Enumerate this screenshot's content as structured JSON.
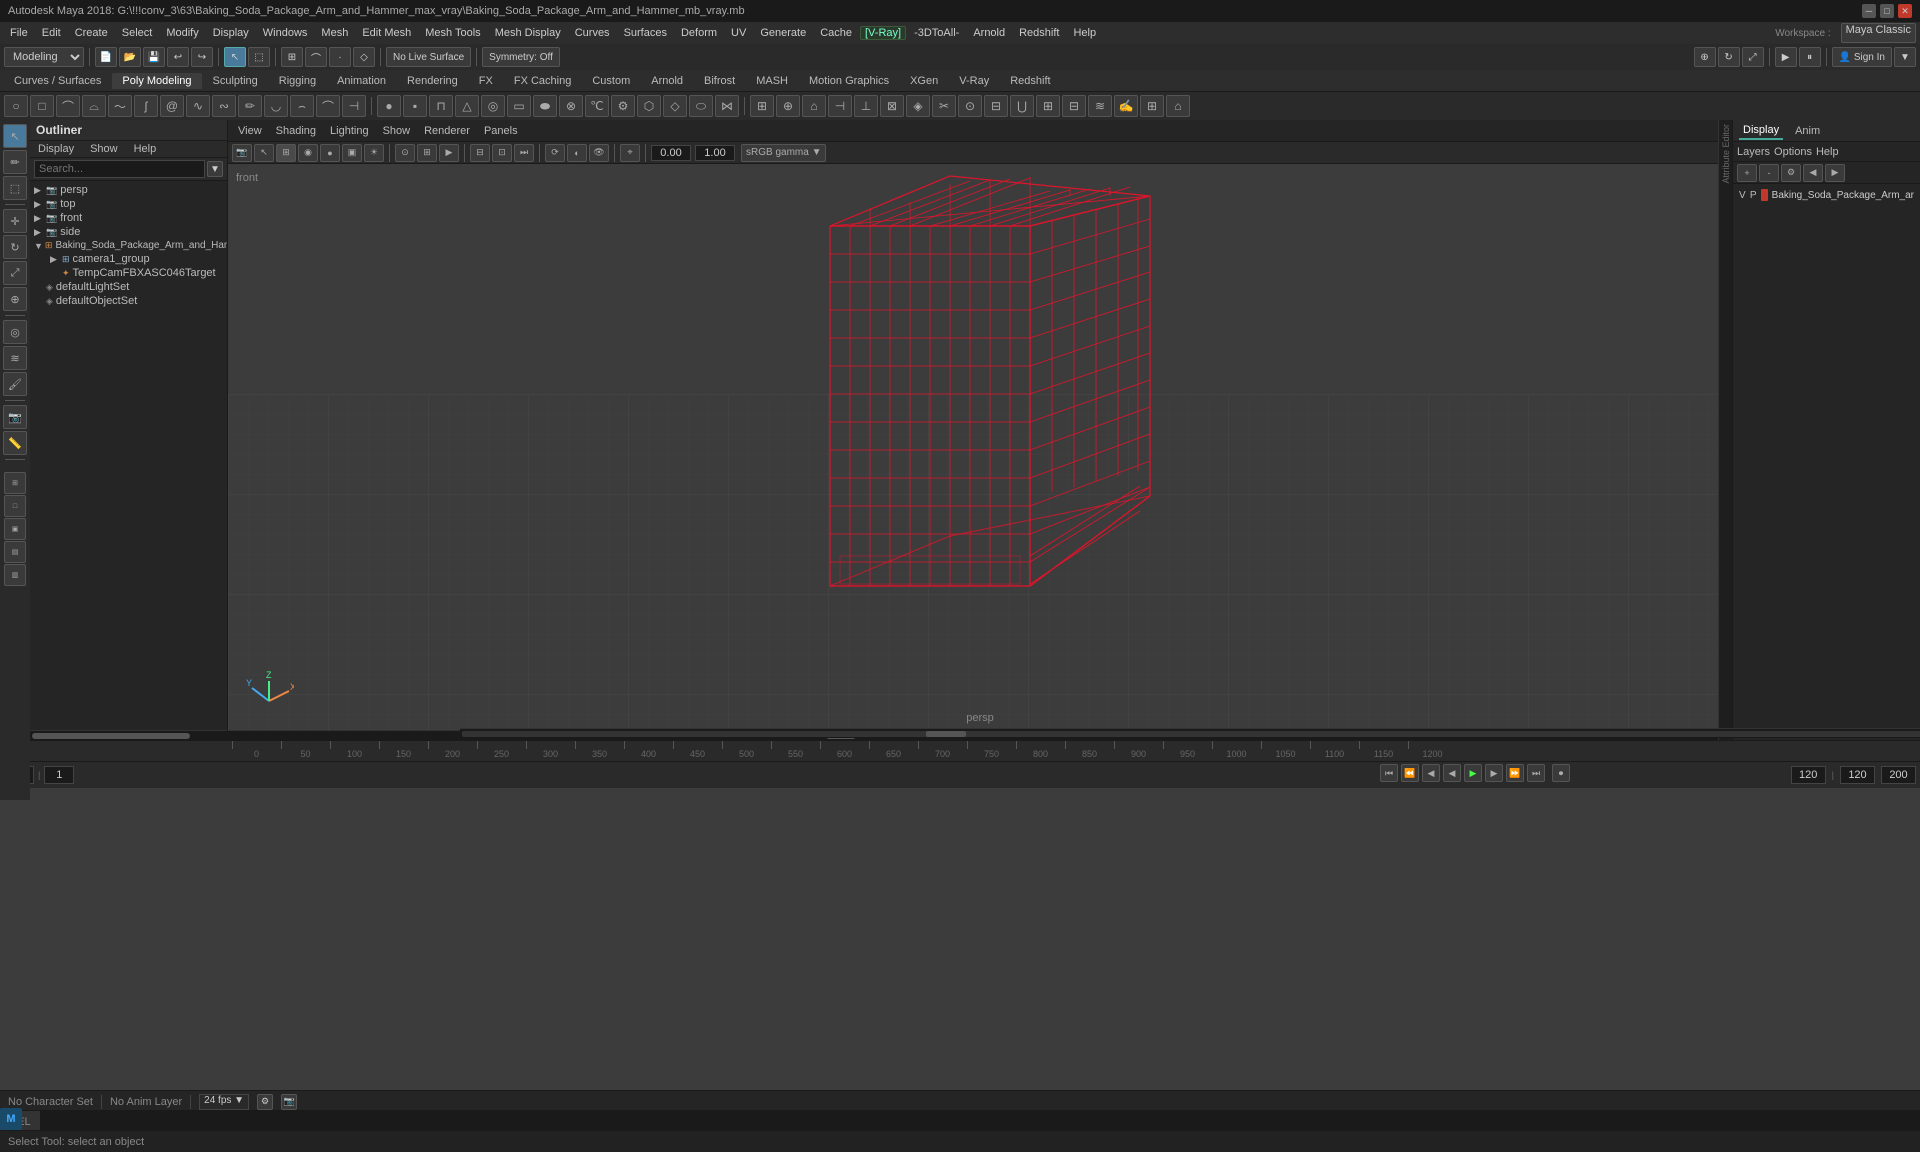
{
  "titleBar": {
    "title": "Autodesk Maya 2018: G:\\!!!conv_3\\63\\Baking_Soda_Package_Arm_and_Hammer_max_vray\\Baking_Soda_Package_Arm_and_Hammer_mb_vray.mb"
  },
  "menuBar": {
    "items": [
      "File",
      "Edit",
      "Create",
      "Select",
      "Modify",
      "Display",
      "Windows",
      "Mesh",
      "Edit Mesh",
      "Mesh Tools",
      "Mesh Display",
      "Curves",
      "Surfaces",
      "Deform",
      "UV",
      "Generate",
      "Cache",
      "V-Ray",
      "3DToAll",
      "Arnold",
      "Redshift",
      "Help"
    ]
  },
  "mainToolbar": {
    "workspace_label": "Workspace :",
    "workspace_value": "Maya Classic",
    "mode_dropdown": "Modeling",
    "no_live_surface": "No Live Surface",
    "symmetry_off": "Symmetry: Off",
    "sign_in": "Sign In"
  },
  "moduleTabs": {
    "items": [
      "Curves / Surfaces",
      "Poly Modeling",
      "Sculpting",
      "Rigging",
      "Animation",
      "Rendering",
      "FX",
      "FX Caching",
      "Custom",
      "Arnold",
      "Bifrost",
      "MASH",
      "Motion Graphics",
      "XGen",
      "V-Ray",
      "Redshift"
    ]
  },
  "outliner": {
    "header": "Outliner",
    "menu": [
      "Display",
      "Show",
      "Help"
    ],
    "search_placeholder": "Search...",
    "items": [
      {
        "label": "persp",
        "indent": 0,
        "type": "camera",
        "expanded": false
      },
      {
        "label": "top",
        "indent": 0,
        "type": "camera",
        "expanded": false
      },
      {
        "label": "front",
        "indent": 0,
        "type": "camera",
        "expanded": false
      },
      {
        "label": "side",
        "indent": 0,
        "type": "camera",
        "expanded": false
      },
      {
        "label": "Baking_Soda_Package_Arm_and_Ham",
        "indent": 0,
        "type": "group",
        "expanded": true
      },
      {
        "label": "camera1_group",
        "indent": 1,
        "type": "group",
        "expanded": false
      },
      {
        "label": "TempCamFBXASC046Target",
        "indent": 2,
        "type": "object",
        "expanded": false
      },
      {
        "label": "defaultLightSet",
        "indent": 0,
        "type": "set",
        "expanded": false
      },
      {
        "label": "defaultObjectSet",
        "indent": 0,
        "type": "set",
        "expanded": false
      }
    ]
  },
  "viewport": {
    "menus": [
      "View",
      "Shading",
      "Lighting",
      "Show",
      "Renderer",
      "Panels"
    ],
    "persp_label": "persp",
    "front_label": "front",
    "gamma_label": "sRGB gamma",
    "field1_value": "0.00",
    "field2_value": "1.00"
  },
  "rightPanel": {
    "tabs": [
      "Display",
      "Anim"
    ],
    "menu": [
      "Layers",
      "Options",
      "Help"
    ],
    "channel_label": "V",
    "channel_p": "P",
    "object_name": "Baking_Soda_Package_Arm_ar",
    "color": "#c0392b"
  },
  "timeline": {
    "ticks": [
      "0",
      "50",
      "100",
      "150",
      "200",
      "250",
      "300",
      "350",
      "400",
      "450",
      "500",
      "550",
      "600",
      "650",
      "700",
      "750",
      "800",
      "850",
      "900",
      "950",
      "1000",
      "1050",
      "1100",
      "1150",
      "1200"
    ],
    "current_frame": "1",
    "start_frame": "1",
    "end_frame": "120",
    "range_end": "200",
    "range_start": "120"
  },
  "transport": {
    "buttons": [
      "⏮",
      "⏭",
      "⏪",
      "◀",
      "▶",
      "⏩",
      "⏭",
      "⏺"
    ],
    "fps": "24 fps",
    "no_anim_layer": "No Anim Layer",
    "no_character_set": "No Character Set"
  },
  "statusBar": {
    "tool": "Select Tool: select an object"
  },
  "mel": {
    "label": "MEL"
  },
  "bottomStatus": {
    "items": [
      "No Character Set",
      "No Anim Layer",
      "24 fps"
    ]
  }
}
